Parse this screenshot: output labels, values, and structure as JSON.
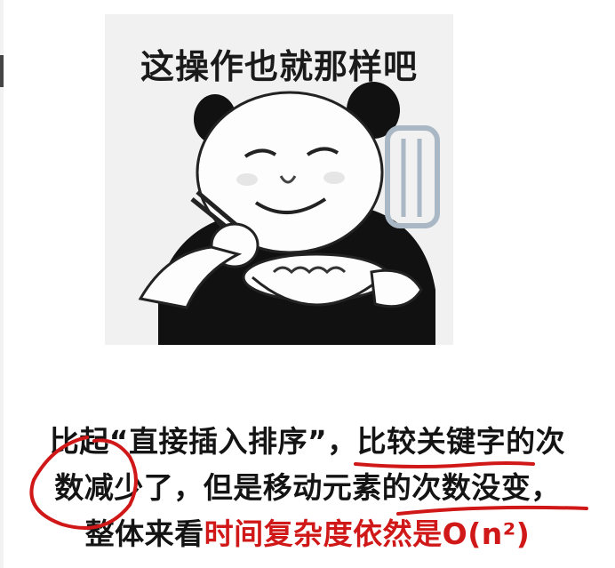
{
  "meme": {
    "caption": "这操作也就那样吧"
  },
  "explanation": {
    "line1": "比起“直接插入排序”，比较关键字的次",
    "line2": "数减少了，但是移动元素的次数没变，",
    "line3_black": "整体来看",
    "line3_red": "时间复杂度依然是O(n²)"
  },
  "colors": {
    "highlight": "#d01818",
    "text": "#141414",
    "meme_bg": "#f1f1f1"
  }
}
